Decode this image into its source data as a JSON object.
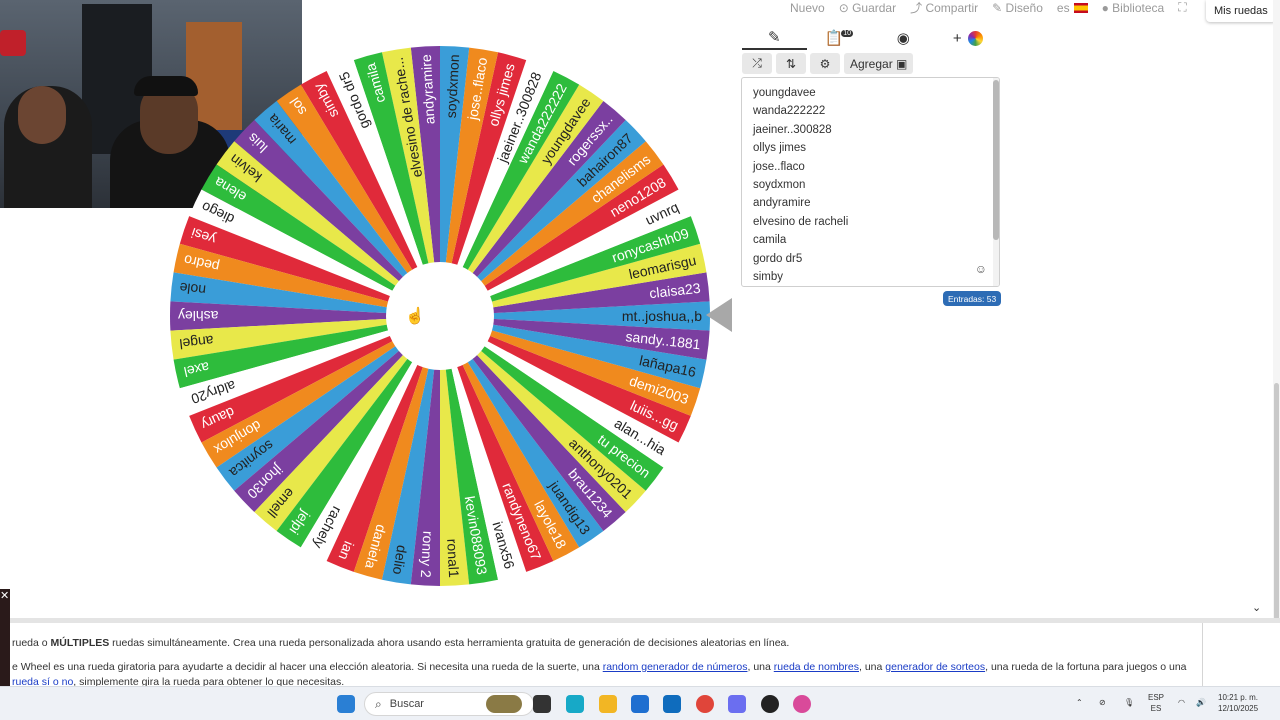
{
  "toolbar": {
    "items": [
      "Nuevo",
      "Guardar",
      "Compartir",
      "Diseño",
      "es",
      "Biblioteca"
    ],
    "my_wheels": "Mis ruedas"
  },
  "panel": {
    "tabs": [
      {
        "icon": "pencil-icon"
      },
      {
        "icon": "results-icon",
        "count": "10"
      },
      {
        "icon": "eye-off-icon"
      },
      {
        "icon": "add-color-icon",
        "label": "+"
      }
    ],
    "add_button": "Agregar",
    "entries_label": "Entradas: 53",
    "list": [
      "youngdavee",
      "wanda222222",
      "jaeiner..300828",
      "ollys jimes",
      "jose..flaco",
      "soydxmon",
      "andyramire",
      "elvesino de racheli",
      "camila",
      "gordo dr5",
      "simby"
    ]
  },
  "wheel": {
    "colors": [
      "#3a9dd8",
      "#7b3fa0",
      "#e8e84a",
      "#2ebc3c",
      "#ffffff",
      "#e02a3a",
      "#f08a1e"
    ],
    "segments": [
      "mt..joshua,,b",
      "claisa23",
      "leomarisgu",
      "ronycashh09",
      "uvnrq",
      "neno1208",
      "chanelisms",
      "bahairon87",
      "rogerssx..",
      "youngdavee",
      "wanda222222",
      "jaeiner..300828",
      "ollys jimes",
      "jose..flaco",
      "soydxmon",
      "andyramire",
      "elvesino de rache...",
      "camila",
      "gordo dr5",
      "simby",
      "sol",
      "maria",
      "luis",
      "kelvin",
      "elena",
      "diego",
      "yesi",
      "pedro",
      "nole",
      "ashley",
      "angel",
      "axel",
      "aldry20",
      "daury",
      "donjulox",
      "soynitca",
      "jhon30",
      "emell",
      "jelpi",
      "rachely",
      "ian",
      "daniela",
      "delio",
      "ronny 2",
      "ronal1",
      "kevin088093",
      "ivanx56",
      "randyneno67",
      "layole18",
      "juandig13",
      "brau1234",
      "anthony0201",
      "tu precion",
      "alan...hia",
      "luiis...gg",
      "demi2003",
      "lañapa16",
      "sandy..1881"
    ],
    "text_colors": [
      "#222222",
      "#ffffff",
      "#222222",
      "#ffffff",
      "#222222",
      "#ffffff",
      "#ffffff"
    ]
  },
  "footer": {
    "line1_pre": "rueda o ",
    "line1_bold": "MÚLTIPLES",
    "line1_post": " ruedas simultáneamente. Crea una rueda personalizada ahora usando esta herramienta gratuita de generación de decisiones aleatorias en línea.",
    "line2_pre": "e Wheel es una rueda giratoria para ayudarte a decidir al hacer una elección aleatoria. Si necesita una rueda de la suerte, una ",
    "link1": "random generador de números",
    "line2_mid1": ", una ",
    "link2": "rueda de nombres",
    "line2_mid2": ", una ",
    "link3": "generador de sorteos",
    "line2_post": ", una rueda de la fortuna para juegos o una",
    "link4": "rueda sí o no",
    "line3_post": ", simplemente gira la rueda para obtener lo que necesitas."
  },
  "taskbar": {
    "search": "Buscar",
    "lang": "ESP",
    "lang2": "ES",
    "time": "10:21 p. m.",
    "date": "12/10/2025"
  }
}
